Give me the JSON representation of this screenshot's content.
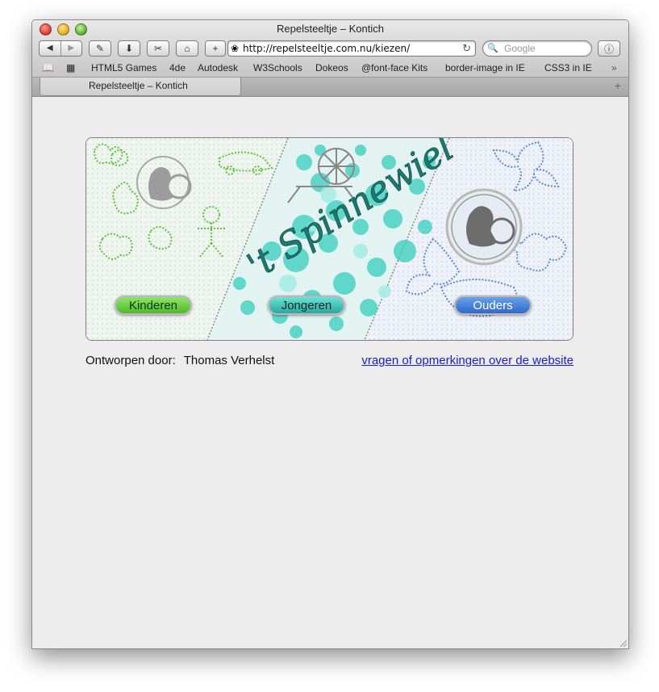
{
  "window": {
    "title": "Repelsteeltje – Kontich"
  },
  "toolbar": {
    "back_icon": "back-arrow-icon",
    "forward_icon": "forward-arrow-icon",
    "url": "http://repelsteeltje.com.nu/kiezen/",
    "search_placeholder": "Google"
  },
  "bookmarks": [
    "HTML5 Games",
    "4de",
    "Autodesk",
    "W3Schools",
    "Dokeos",
    "@font-face Kits",
    "border-image in IE",
    "CSS3 in IE"
  ],
  "tab": {
    "label": "Repelsteeltje – Kontich"
  },
  "banner": {
    "logo_text": "'t Spinnewiel",
    "buttons": {
      "kinderen": "Kinderen",
      "jongeren": "Jongeren",
      "ouders": "Ouders"
    }
  },
  "footer": {
    "designed_by_label": "Ontworpen door:",
    "designer": "Thomas Verhelst",
    "contact_link": "vragen of opmerkingen over de website"
  },
  "colors": {
    "kinderen": "#4fb92c",
    "jongeren": "#2aa89e",
    "ouders": "#2f69c9",
    "link": "#1a1ad6"
  }
}
